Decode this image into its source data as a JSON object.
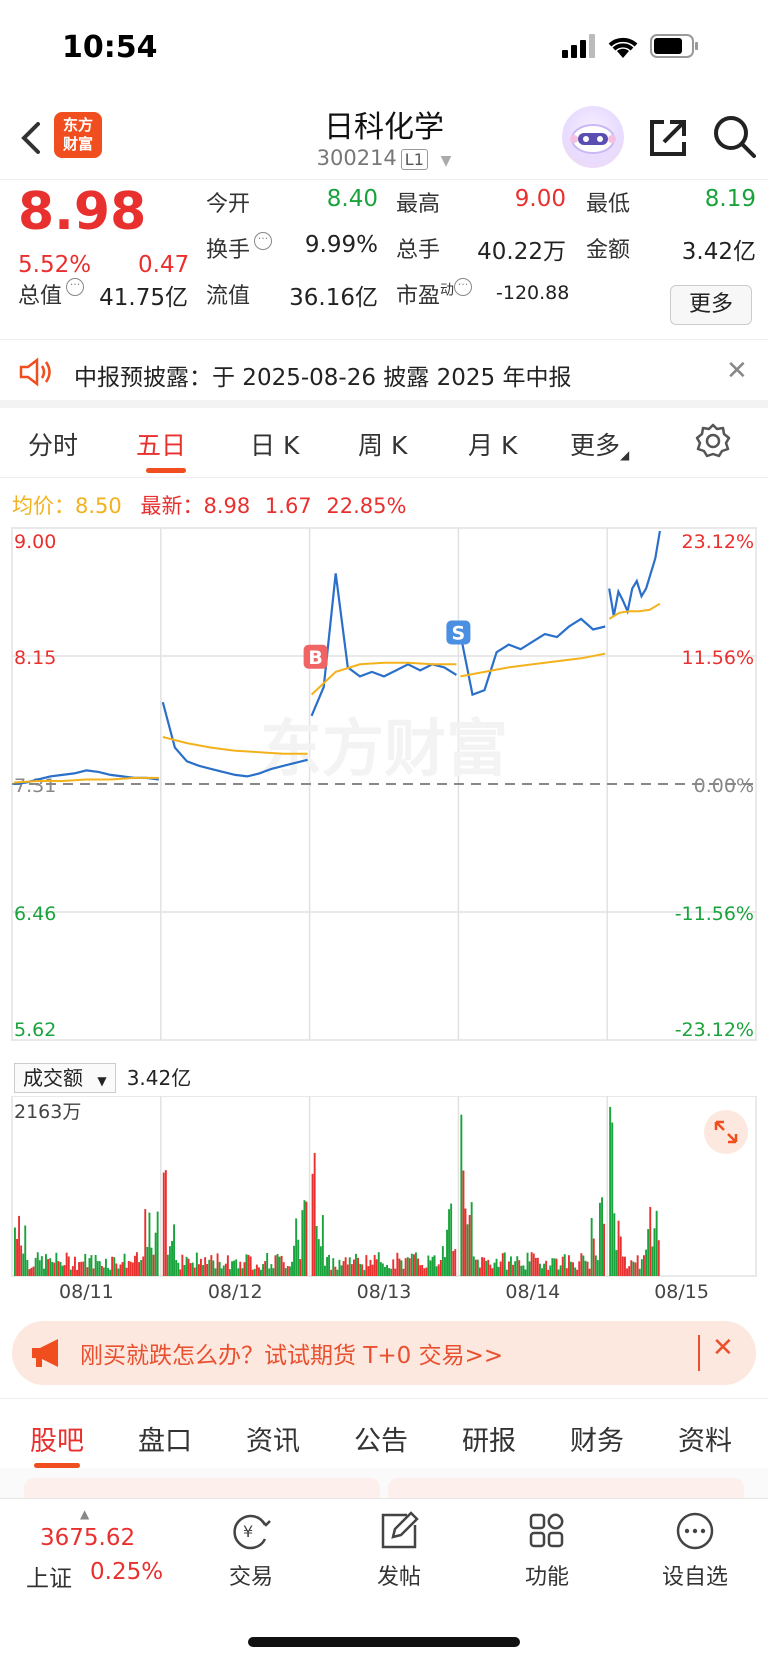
{
  "status_bar": {
    "time": "10:54"
  },
  "header": {
    "logo_line1": "东方",
    "logo_line2": "财富",
    "stock_name": "日科化学",
    "stock_code": "300214",
    "level_badge": "L1"
  },
  "quote": {
    "price": "8.98",
    "change_pct": "5.52%",
    "change_val": "0.47",
    "fields": [
      {
        "label": "今开",
        "value": "8.40",
        "color": "#1aa33c"
      },
      {
        "label": "最高",
        "value": "9.00",
        "color": "#e8302f"
      },
      {
        "label": "最低",
        "value": "8.19",
        "color": "#1aa33c"
      },
      {
        "label": "换手",
        "value": "9.99%",
        "color": "#222222"
      },
      {
        "label": "总手",
        "value": "40.22万",
        "color": "#222222"
      },
      {
        "label": "金额",
        "value": "3.42亿",
        "color": "#222222"
      },
      {
        "label": "总值",
        "value": "41.75亿",
        "color": "#222222"
      },
      {
        "label": "流值",
        "value": "36.16亿",
        "color": "#222222"
      },
      {
        "label": "市盈",
        "value": "-120.88",
        "color": "#222222"
      }
    ],
    "pe_superscript": "动",
    "more_label": "更多"
  },
  "notice": {
    "text": "中报预披露：于 2025-08-26 披露 2025 年中报"
  },
  "chart_tabs": [
    "分时",
    "五日",
    "日 K",
    "周 K",
    "月 K",
    "更多"
  ],
  "legend": {
    "avg_label": "均价：",
    "avg_value": "8.50",
    "latest_label": "最新：",
    "latest_value": "8.98",
    "latest_change": "1.67",
    "latest_pct": "22.85%"
  },
  "chart_data": {
    "type": "line",
    "x": [
      "08/11",
      "08/12",
      "08/13",
      "08/14",
      "08/15"
    ],
    "ylim": [
      5.62,
      9.0
    ],
    "y_ticks_left": [
      "9.00",
      "8.15",
      "7.31",
      "6.46",
      "5.62"
    ],
    "y_ticks_right": [
      "23.12%",
      "11.56%",
      "0.00%",
      "-11.56%",
      "-23.12%"
    ],
    "prev_close": 7.31,
    "series": [
      {
        "name": "最新",
        "color": "#2a6fc9",
        "days": [
          [
            7.31,
            7.32,
            7.34,
            7.36,
            7.37,
            7.38,
            7.4,
            7.39,
            7.37,
            7.36,
            7.35,
            7.35,
            7.34
          ],
          [
            7.85,
            7.55,
            7.46,
            7.43,
            7.41,
            7.39,
            7.37,
            7.36,
            7.38,
            7.41,
            7.43,
            7.45,
            7.47
          ],
          [
            7.76,
            7.95,
            8.7,
            8.08,
            8.02,
            8.05,
            8.02,
            8.06,
            8.1,
            8.06,
            8.1,
            8.08,
            8.03
          ],
          [
            8.3,
            7.9,
            7.93,
            8.18,
            8.23,
            8.2,
            8.25,
            8.3,
            8.28,
            8.35,
            8.4,
            8.33,
            8.35
          ],
          [
            8.6,
            8.42,
            8.58,
            8.52,
            8.45,
            8.6,
            8.65,
            8.55,
            8.6,
            8.7,
            8.8,
            8.98
          ]
        ]
      },
      {
        "name": "均价",
        "color": "#f3b21c",
        "days": [
          [
            7.32,
            7.33,
            7.33,
            7.34,
            7.34,
            7.35,
            7.35
          ],
          [
            7.62,
            7.58,
            7.55,
            7.53,
            7.52,
            7.51,
            7.51
          ],
          [
            7.9,
            8.05,
            8.1,
            8.11,
            8.11,
            8.1,
            8.1
          ],
          [
            8.02,
            8.05,
            8.08,
            8.1,
            8.12,
            8.14,
            8.17
          ],
          [
            8.4,
            8.44,
            8.45,
            8.45,
            8.46,
            8.5
          ]
        ]
      }
    ],
    "markers": [
      {
        "label": "B",
        "day": 2,
        "value": 8.15
      },
      {
        "label": "S",
        "day": 3,
        "value": 8.31
      }
    ],
    "watermark": "东方财富"
  },
  "volume": {
    "selector_label": "成交额",
    "total": "3.42亿",
    "max_label": "2163万"
  },
  "promo": {
    "text": "刚买就跌怎么办？试试期货 T+0 交易>>"
  },
  "sub_tabs": [
    "股吧",
    "盘口",
    "资讯",
    "公告",
    "研报",
    "财务",
    "资料"
  ],
  "bottom_bar": {
    "index_value": "3675.62",
    "index_name": "上证",
    "index_pct": "0.25%",
    "items": [
      "交易",
      "发帖",
      "功能",
      "设自选"
    ]
  },
  "colors": {
    "up": "#e8302f",
    "down": "#1aa33c",
    "price_line": "#2a6fc9",
    "avg_line": "#f3b21c",
    "accent": "#f04e1e"
  }
}
